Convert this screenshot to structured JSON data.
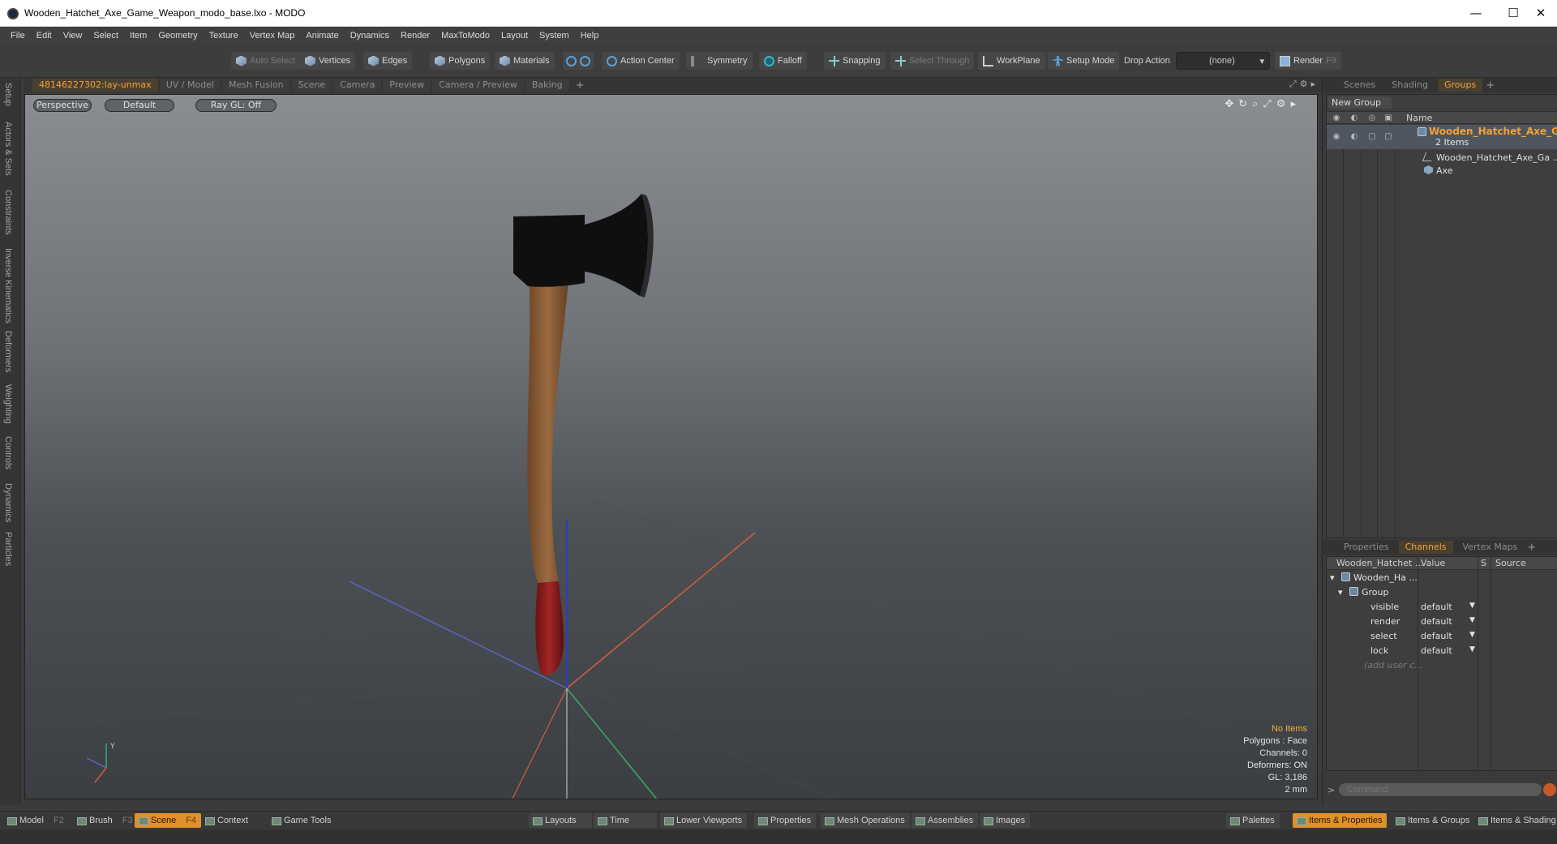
{
  "window": {
    "title": "Wooden_Hatchet_Axe_Game_Weapon_modo_base.lxo - MODO",
    "minimize": "—",
    "maximize": "☐",
    "close": "✕"
  },
  "menu": [
    "File",
    "Edit",
    "View",
    "Select",
    "Item",
    "Geometry",
    "Texture",
    "Vertex Map",
    "Animate",
    "Dynamics",
    "Render",
    "MaxToModo",
    "Layout",
    "System",
    "Help"
  ],
  "toolbar": {
    "auto_select": "Auto Select",
    "vertices": "Vertices",
    "edges": "Edges",
    "polygons": "Polygons",
    "materials": "Materials",
    "action_center": "Action Center",
    "symmetry": "Symmetry",
    "falloff": "Falloff",
    "snapping": "Snapping",
    "select_through": "Select Through",
    "workplane": "WorkPlane",
    "setup_mode": "Setup Mode",
    "drop_action": "Drop Action",
    "drop_value": "(none)",
    "render": "Render",
    "render_key": "F9"
  },
  "viewport_tabs": [
    "48146227302:lay-unmax",
    "UV / Model",
    "Mesh Fusion",
    "Scene",
    "Camera",
    "Preview",
    "Camera / Preview",
    "Baking"
  ],
  "viewport_tabs_plus": "+",
  "left_tabs": [
    "Setup",
    "Actors & Sets",
    "Constraints",
    "Inverse Kinematics",
    "Deformers",
    "Weighting",
    "Controls",
    "Dynamics",
    "Particles"
  ],
  "viewport": {
    "view": "Perspective",
    "shading": "Default",
    "raygl": "Ray GL: Off",
    "info": {
      "items": "No Items",
      "polygons": "Polygons : Face",
      "channels": "Channels: 0",
      "deformers": "Deformers: ON",
      "gl": "GL: 3,186",
      "scale": "2 mm"
    },
    "axis_label": "Y"
  },
  "groups_panel": {
    "tabs": [
      "Scenes",
      "Shading",
      "Groups"
    ],
    "active_tab": "Groups",
    "plus": "+",
    "new_group": "New Group",
    "col_name": "Name",
    "group_name": "Wooden_Hatchet_Axe_G...",
    "group_count": "2 Items",
    "children": [
      "Wooden_Hatchet_Axe_Ga ...",
      "Axe"
    ]
  },
  "channels_panel": {
    "tabs": [
      "Properties",
      "Channels",
      "Vertex Maps"
    ],
    "active_tab": "Channels",
    "plus": "+",
    "headers": {
      "name": "Wooden_Hatchet ...",
      "value": "Value",
      "s": "S",
      "source": "Source"
    },
    "root": "Wooden_Ha ...",
    "group": "Group",
    "rows": [
      {
        "name": "visible",
        "value": "default"
      },
      {
        "name": "render",
        "value": "default"
      },
      {
        "name": "select",
        "value": "default"
      },
      {
        "name": "lock",
        "value": "default"
      }
    ],
    "add_user": "(add user c...",
    "command_placeholder": "Command",
    "prompt": ">"
  },
  "bottom": {
    "model": "Model",
    "model_key": "F2",
    "brush": "Brush",
    "brush_key": "F3",
    "scene": "Scene",
    "scene_key": "F4",
    "context": "Context",
    "game_tools": "Game Tools",
    "layouts": "Layouts",
    "time": "Time",
    "lower_viewports": "Lower Viewports",
    "properties": "Properties",
    "mesh_operations": "Mesh Operations",
    "assemblies": "Assemblies",
    "images": "Images",
    "palettes": "Palettes",
    "items_properties": "Items & Properties",
    "items_groups": "Items & Groups",
    "items_shading": "Items & Shading"
  },
  "colors": {
    "accent": "#f2a23a",
    "axe_head": "#111111",
    "handle_wood": "#8a5a33",
    "handle_grip": "#8e1e1e"
  }
}
